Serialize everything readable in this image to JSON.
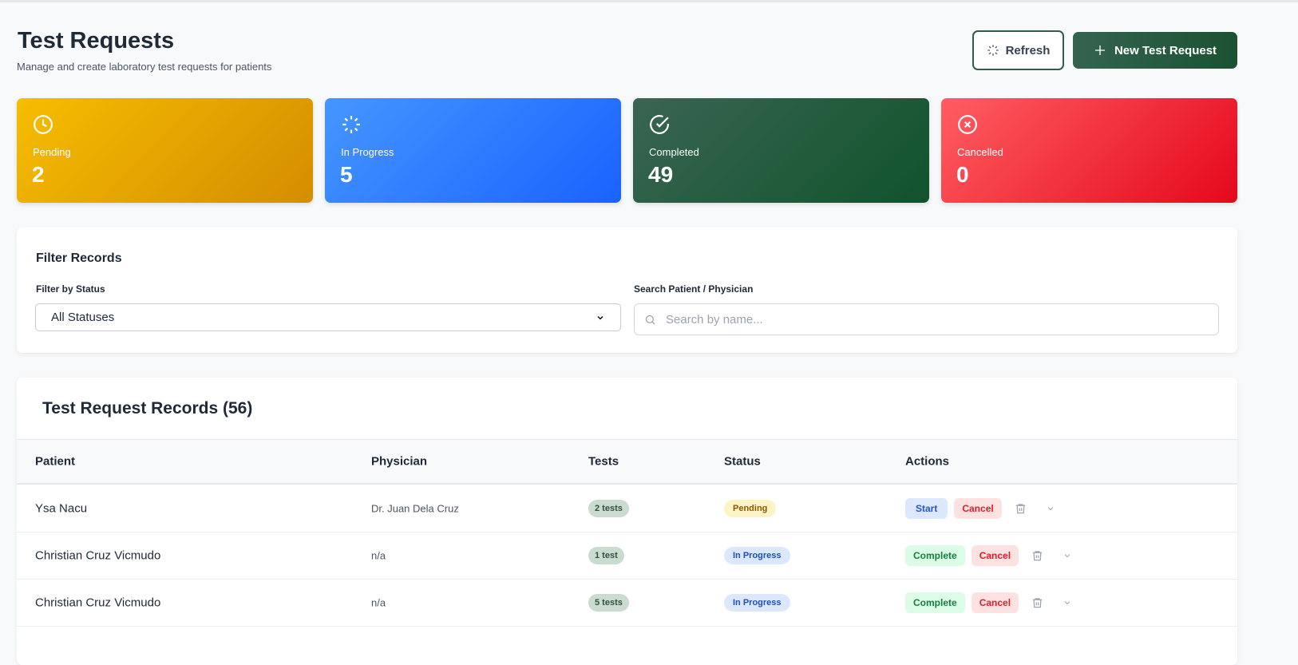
{
  "header": {
    "title": "Test Requests",
    "subtitle": "Manage and create laboratory test requests for patients",
    "refresh_label": "Refresh",
    "new_label": "New Test Request"
  },
  "stats": [
    {
      "label": "Pending",
      "value": "2",
      "icon": "clock-icon",
      "color": "#f5b800"
    },
    {
      "label": "In Progress",
      "value": "5",
      "icon": "loader-icon",
      "color": "#3b8bff"
    },
    {
      "label": "Completed",
      "value": "49",
      "icon": "check-circle-icon",
      "color": "#2f5e49"
    },
    {
      "label": "Cancelled",
      "value": "0",
      "icon": "x-circle-icon",
      "color": "#ff5a5f"
    }
  ],
  "filter": {
    "title": "Filter Records",
    "status_label": "Filter by Status",
    "status_value": "All Statuses",
    "search_label": "Search Patient / Physician",
    "search_placeholder": "Search by name..."
  },
  "table": {
    "title": "Test Request Records (56)",
    "headers": [
      "Patient",
      "Physician",
      "Tests",
      "Status",
      "Actions"
    ],
    "rows": [
      {
        "patient": "Ysa Nacu",
        "physician": "Dr. Juan Dela Cruz",
        "tests": "2 tests",
        "status": "Pending",
        "primary": "Start",
        "cancel": "Cancel"
      },
      {
        "patient": "Christian Cruz Vicmudo",
        "physician": "n/a",
        "tests": "1 test",
        "status": "In Progress",
        "primary": "Complete",
        "cancel": "Cancel"
      },
      {
        "patient": "Christian Cruz Vicmudo",
        "physician": "n/a",
        "tests": "5 tests",
        "status": "In Progress",
        "primary": "Complete",
        "cancel": "Cancel"
      }
    ]
  }
}
